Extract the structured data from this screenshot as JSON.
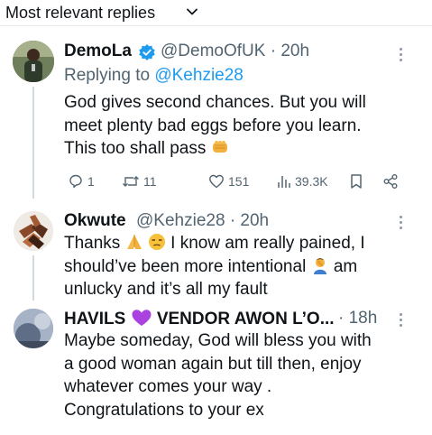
{
  "header": {
    "title": "Most relevant replies"
  },
  "replies": [
    {
      "name": "DemoLa",
      "handle": "@DemoOfUK",
      "sep": "·",
      "time": "20h",
      "replying_prefix": "Replying to",
      "replying_handle": "@Kehzie28",
      "lines": [
        "God gives second chances. But you will",
        "meet plenty bad eggs before you learn.",
        "This too shall pass"
      ],
      "emojis": [
        "fist-bump"
      ],
      "actions": {
        "replies": "1",
        "reposts": "11",
        "likes": "151",
        "views": "39.3K"
      }
    },
    {
      "name": "Okwute",
      "handle": "@Kehzie28",
      "sep": "·",
      "time": "20h",
      "lines": [
        "Thanks",
        "I know am really pained, I",
        "should’ve been more intentional",
        "am",
        "unlucky and it’s all my fault"
      ],
      "emojis": [
        "folded-hands",
        "unamused-face",
        "person-facepalming"
      ]
    },
    {
      "name_part1": "HAVILS",
      "name_part2": "VENDOR AWON L’O...",
      "sep": "·",
      "time": "18h",
      "lines": [
        "Maybe someday, God will bless you with",
        "a good woman again but till then, enjoy",
        "whatever comes your way .",
        "Congratulations to your ex"
      ],
      "emojis": [
        "purple-heart"
      ]
    }
  ],
  "colors": {
    "text": "#0f1419",
    "secondary": "#536471",
    "accent": "#1d9bf0",
    "thread_line": "#cfd9de"
  }
}
